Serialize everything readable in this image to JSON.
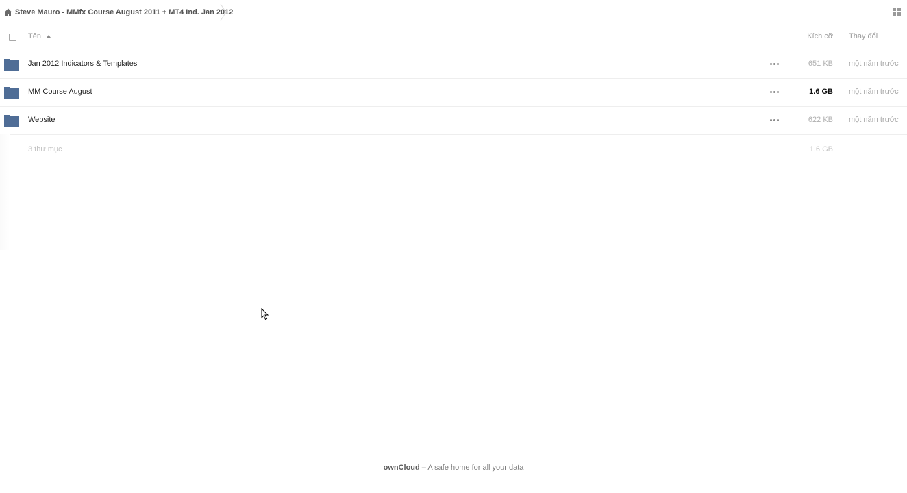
{
  "breadcrumb": {
    "home_icon": "home-icon",
    "current": "Steve Mauro - MMfx Course August 2011 + MT4 Ind. Jan 2012"
  },
  "view_toggle_icon": "grid-view-icon",
  "table": {
    "headers": {
      "name": "Tên",
      "size": "Kích cỡ",
      "modified": "Thay đổi"
    },
    "sort": "name-ascending",
    "rows": [
      {
        "icon": "folder-icon",
        "name": "Jan 2012 Indicators & Templates",
        "size": "651 KB",
        "modified": "một năm trước"
      },
      {
        "icon": "folder-icon",
        "name": "MM Course August",
        "size": "1.6 GB",
        "modified": "một năm trước"
      },
      {
        "icon": "folder-icon",
        "name": "Website",
        "size": "622 KB",
        "modified": "một năm trước"
      }
    ],
    "summary": {
      "count": "3 thư mục",
      "total_size": "1.6 GB"
    }
  },
  "footer": {
    "brand": "ownCloud",
    "tagline": " – A safe home for all your data"
  },
  "colors": {
    "folder": "#4f6d96",
    "row_border": "#eeeeee",
    "muted_text": "#a8a8a8"
  }
}
